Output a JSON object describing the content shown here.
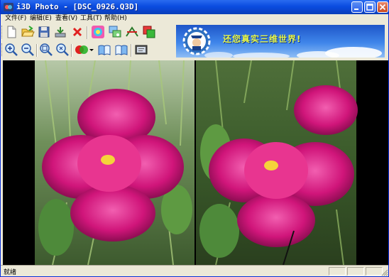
{
  "window": {
    "title": "i3D Photo - [DSC_0926.Q3D]"
  },
  "menu": [
    {
      "label": "文件(F)"
    },
    {
      "label": "编辑(E)"
    },
    {
      "label": "查看(V)"
    },
    {
      "label": "工具(T)"
    },
    {
      "label": "帮助(H)"
    }
  ],
  "toolbar_row1": [
    "new-file-icon",
    "open-folder-icon",
    "save-icon",
    "export-icon",
    "delete-icon",
    "color-wheel-icon",
    "image-convert-icon",
    "stereo-adjust-icon",
    "layers-icon"
  ],
  "toolbar_row2": [
    "zoom-in-icon",
    "zoom-out-icon",
    "zoom-fit-icon",
    "zoom-actual-icon",
    "anaglyph-icon",
    "dropdown-arrow-icon",
    "book-left-icon",
    "book-right-icon",
    "slideshow-icon"
  ],
  "banner": {
    "text": "还您真实三维世界!"
  },
  "viewer": {
    "mode": "side-by-side stereo pair",
    "subject": "magenta peony flower"
  },
  "status": {
    "text": "就绪"
  },
  "colors": {
    "titlebar": "#0a4ce0",
    "chrome": "#ece9d8",
    "banner_text": "#e7f74a",
    "flower": "#d0157a"
  }
}
